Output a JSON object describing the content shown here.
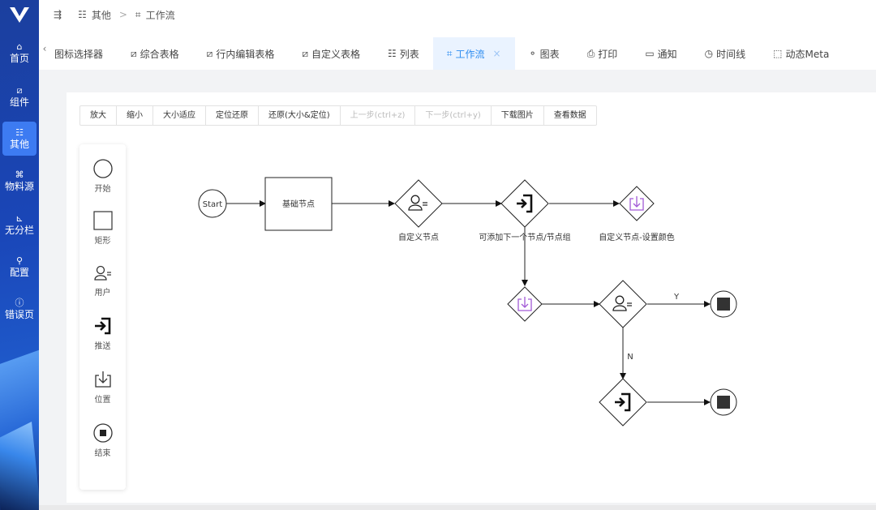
{
  "sidebar": {
    "items": [
      {
        "icon": "⌂",
        "label": "首页"
      },
      {
        "icon": "⧄",
        "label": "组件"
      },
      {
        "icon": "☷",
        "label": "其他"
      },
      {
        "icon": "⌘",
        "label": "物料源"
      },
      {
        "icon": "⊾",
        "label": "无分栏"
      },
      {
        "icon": "⚲",
        "label": "配置"
      },
      {
        "icon": "ⓘ",
        "label": "错误页"
      }
    ]
  },
  "breadcrumb": {
    "menu_icon": "⇶",
    "items": [
      {
        "icon": "☷",
        "label": "其他"
      },
      {
        "icon": "⌗",
        "label": "工作流"
      }
    ],
    "separator": ">"
  },
  "tabs": {
    "prev_arrow": "‹",
    "items": [
      {
        "icon": "",
        "label": "图标选择器"
      },
      {
        "icon": "⧄",
        "label": "综合表格"
      },
      {
        "icon": "⧄",
        "label": "行内编辑表格"
      },
      {
        "icon": "⧄",
        "label": "自定义表格"
      },
      {
        "icon": "☷",
        "label": "列表"
      },
      {
        "icon": "⌗",
        "label": "工作流",
        "active": true,
        "close": "×"
      },
      {
        "icon": "⚬",
        "label": "图表"
      },
      {
        "icon": "⎙",
        "label": "打印"
      },
      {
        "icon": "▭",
        "label": "通知"
      },
      {
        "icon": "◷",
        "label": "时间线"
      },
      {
        "icon": "⬚",
        "label": "动态Meta"
      }
    ]
  },
  "toolbar": {
    "buttons": [
      {
        "label": "放大",
        "disabled": false
      },
      {
        "label": "缩小",
        "disabled": false
      },
      {
        "label": "大小适应",
        "disabled": false
      },
      {
        "label": "定位还原",
        "disabled": false
      },
      {
        "label": "还原(大小&定位)",
        "disabled": false
      },
      {
        "label": "上一步(ctrl+z)",
        "disabled": true
      },
      {
        "label": "下一步(ctrl+y)",
        "disabled": true
      },
      {
        "label": "下载图片",
        "disabled": false
      },
      {
        "label": "查看数据",
        "disabled": false
      }
    ]
  },
  "palette": {
    "items": [
      {
        "icon": "circle-icon",
        "label": "开始"
      },
      {
        "icon": "rect-icon",
        "label": "矩形"
      },
      {
        "icon": "user-icon",
        "label": "用户"
      },
      {
        "icon": "push-icon",
        "label": "推送"
      },
      {
        "icon": "download-icon",
        "label": "位置"
      },
      {
        "icon": "stop-icon",
        "label": "结束"
      }
    ]
  },
  "flow": {
    "start_label": "Start",
    "task_label": "基础节点",
    "custom_node_label": "自定义节点",
    "push_node_label": "可添加下一个节点/节点组",
    "color_node_label": "自定义节点-设置颜色",
    "edge_y": "Y",
    "edge_n": "N"
  },
  "colors": {
    "accent": "#2d8cf0",
    "purple": "#9b4fd0",
    "sidebar_active": "#3d7bf2"
  }
}
